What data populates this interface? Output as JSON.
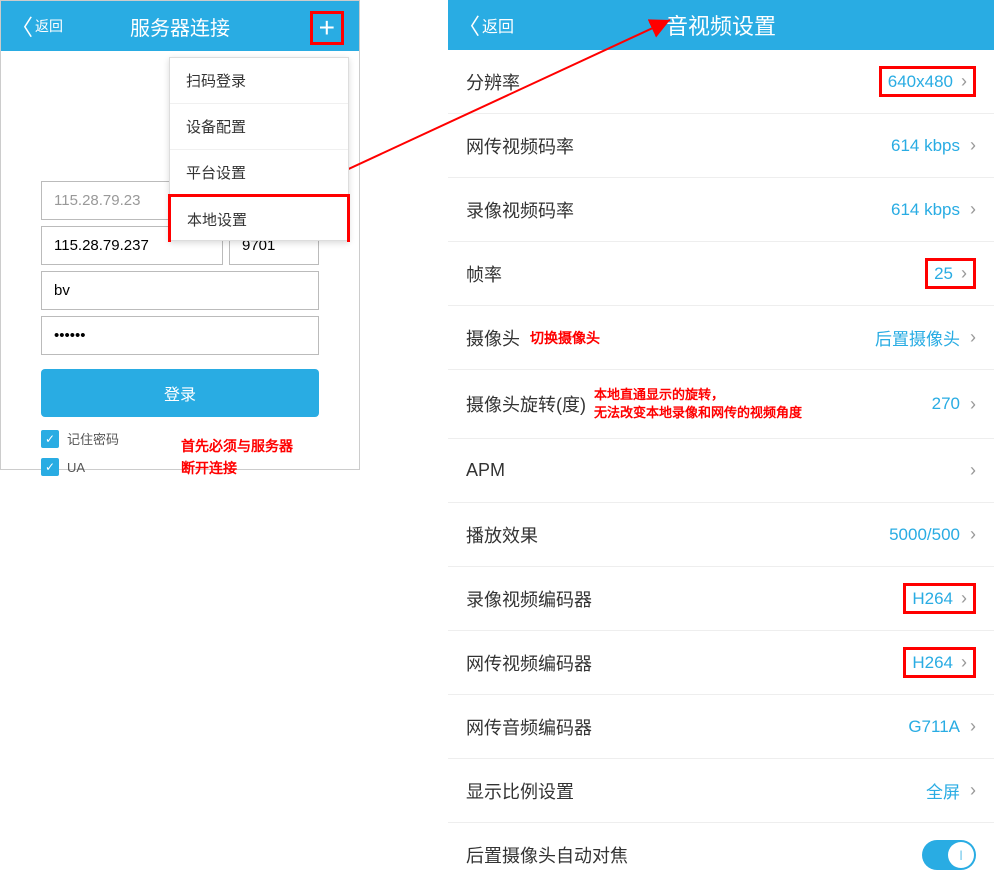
{
  "left": {
    "back_label": "返回",
    "title": "服务器连接",
    "plus_icon": "+",
    "menu": {
      "scan_login": "扫码登录",
      "device_config": "设备配置",
      "platform_settings": "平台设置",
      "local_settings": "本地设置"
    },
    "form": {
      "server_disabled": "115.28.79.23",
      "server": "115.28.79.237",
      "port": "9701",
      "username": "bv",
      "password": "••••••",
      "login_label": "登录",
      "remember_label": "记住密码",
      "ua_label": "UA"
    },
    "note1": "首先必须与服务器",
    "note2": "断开连接"
  },
  "right": {
    "back_label": "返回",
    "title": "音视频设置",
    "rows": {
      "resolution": {
        "label": "分辨率",
        "value": "640x480"
      },
      "net_bitrate": {
        "label": "网传视频码率",
        "value": "614 kbps"
      },
      "rec_bitrate": {
        "label": "录像视频码率",
        "value": "614 kbps"
      },
      "framerate": {
        "label": "帧率",
        "value": "25"
      },
      "camera": {
        "label": "摄像头",
        "value": "后置摄像头",
        "anno": "切换摄像头"
      },
      "rotation": {
        "label": "摄像头旋转(度)",
        "value": "270",
        "anno1": "本地直通显示的旋转，",
        "anno2": "无法改变本地录像和网传的视频角度"
      },
      "apm": {
        "label": "APM",
        "value": ""
      },
      "playback": {
        "label": "播放效果",
        "value": "5000/500"
      },
      "rec_encoder": {
        "label": "录像视频编码器",
        "value": "H264"
      },
      "net_encoder": {
        "label": "网传视频编码器",
        "value": "H264"
      },
      "audio_encoder": {
        "label": "网传音频编码器",
        "value": "G711A"
      },
      "aspect": {
        "label": "显示比例设置",
        "value": "全屏"
      },
      "autofocus": {
        "label": "后置摄像头自动对焦"
      }
    }
  }
}
